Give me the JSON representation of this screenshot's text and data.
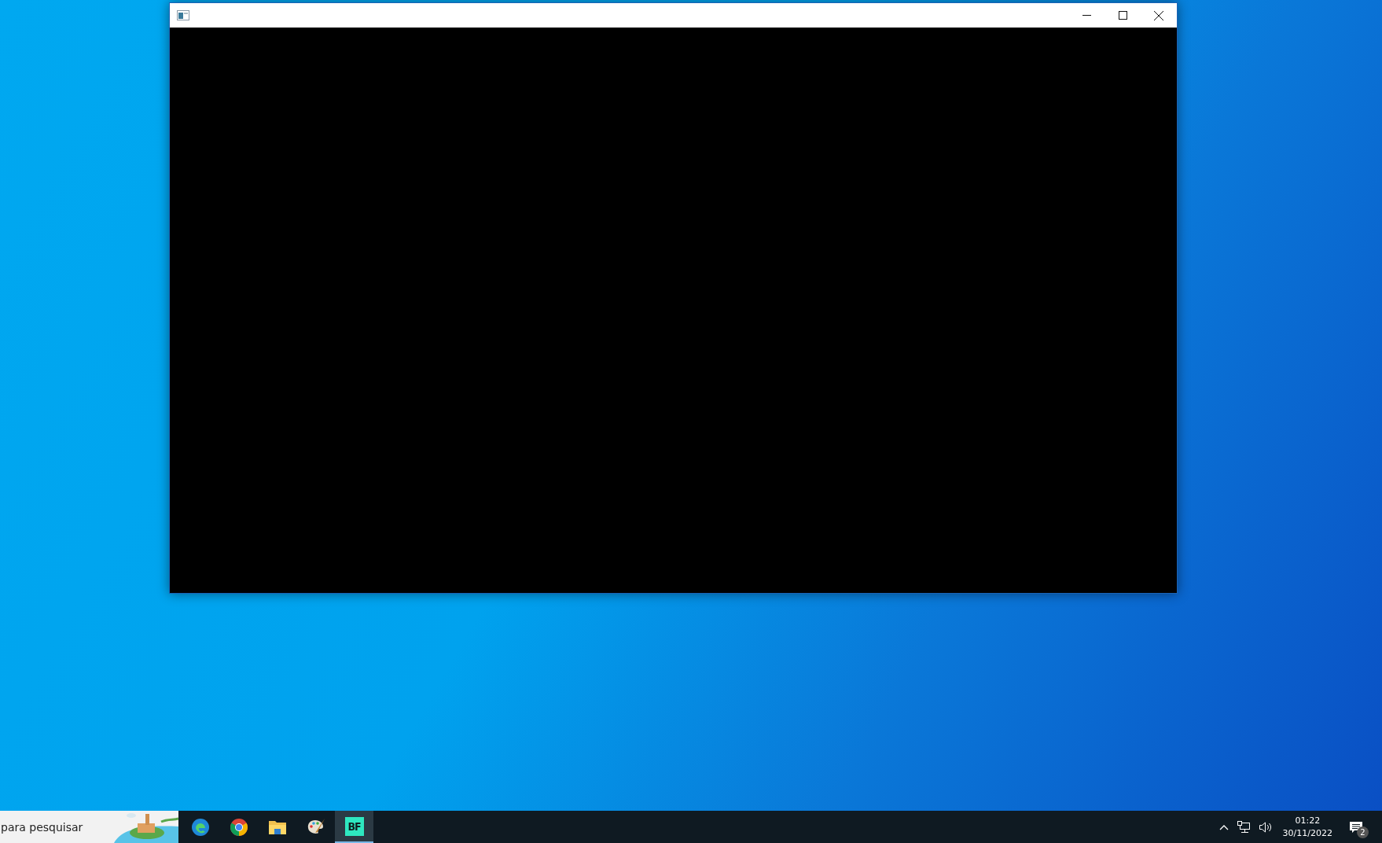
{
  "window": {
    "active": true
  },
  "taskbar": {
    "search": {
      "placeholder": "para pesquisar"
    },
    "apps": [
      {
        "kind": "edge",
        "selected": false
      },
      {
        "kind": "chrome",
        "selected": false
      },
      {
        "kind": "folder",
        "selected": false
      },
      {
        "kind": "paint",
        "selected": false
      },
      {
        "kind": "bf",
        "label": "BF",
        "selected": true
      }
    ],
    "clock": {
      "time": "01:22",
      "date": "30/11/2022"
    },
    "notifications": {
      "count": "2"
    }
  }
}
